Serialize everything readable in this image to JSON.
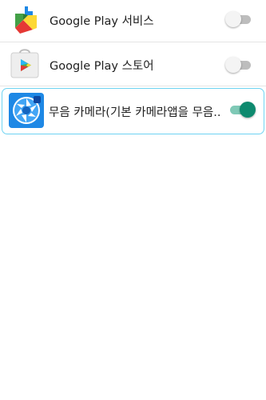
{
  "apps": [
    {
      "label": "Google Play 서비스",
      "icon": "google-play-services-icon",
      "enabled": false
    },
    {
      "label": "Google Play 스토어",
      "icon": "google-play-store-icon",
      "enabled": false
    },
    {
      "label": "무음 카메라(기본 카메라앱을 무음..",
      "icon": "silent-camera-shutter-icon",
      "enabled": true
    }
  ],
  "colors": {
    "toggle_on_thumb": "#0e8a6f",
    "toggle_on_track": "#7fc9b6",
    "toggle_off_track": "#bdbdbd",
    "selection_border": "#6ed3f2"
  }
}
